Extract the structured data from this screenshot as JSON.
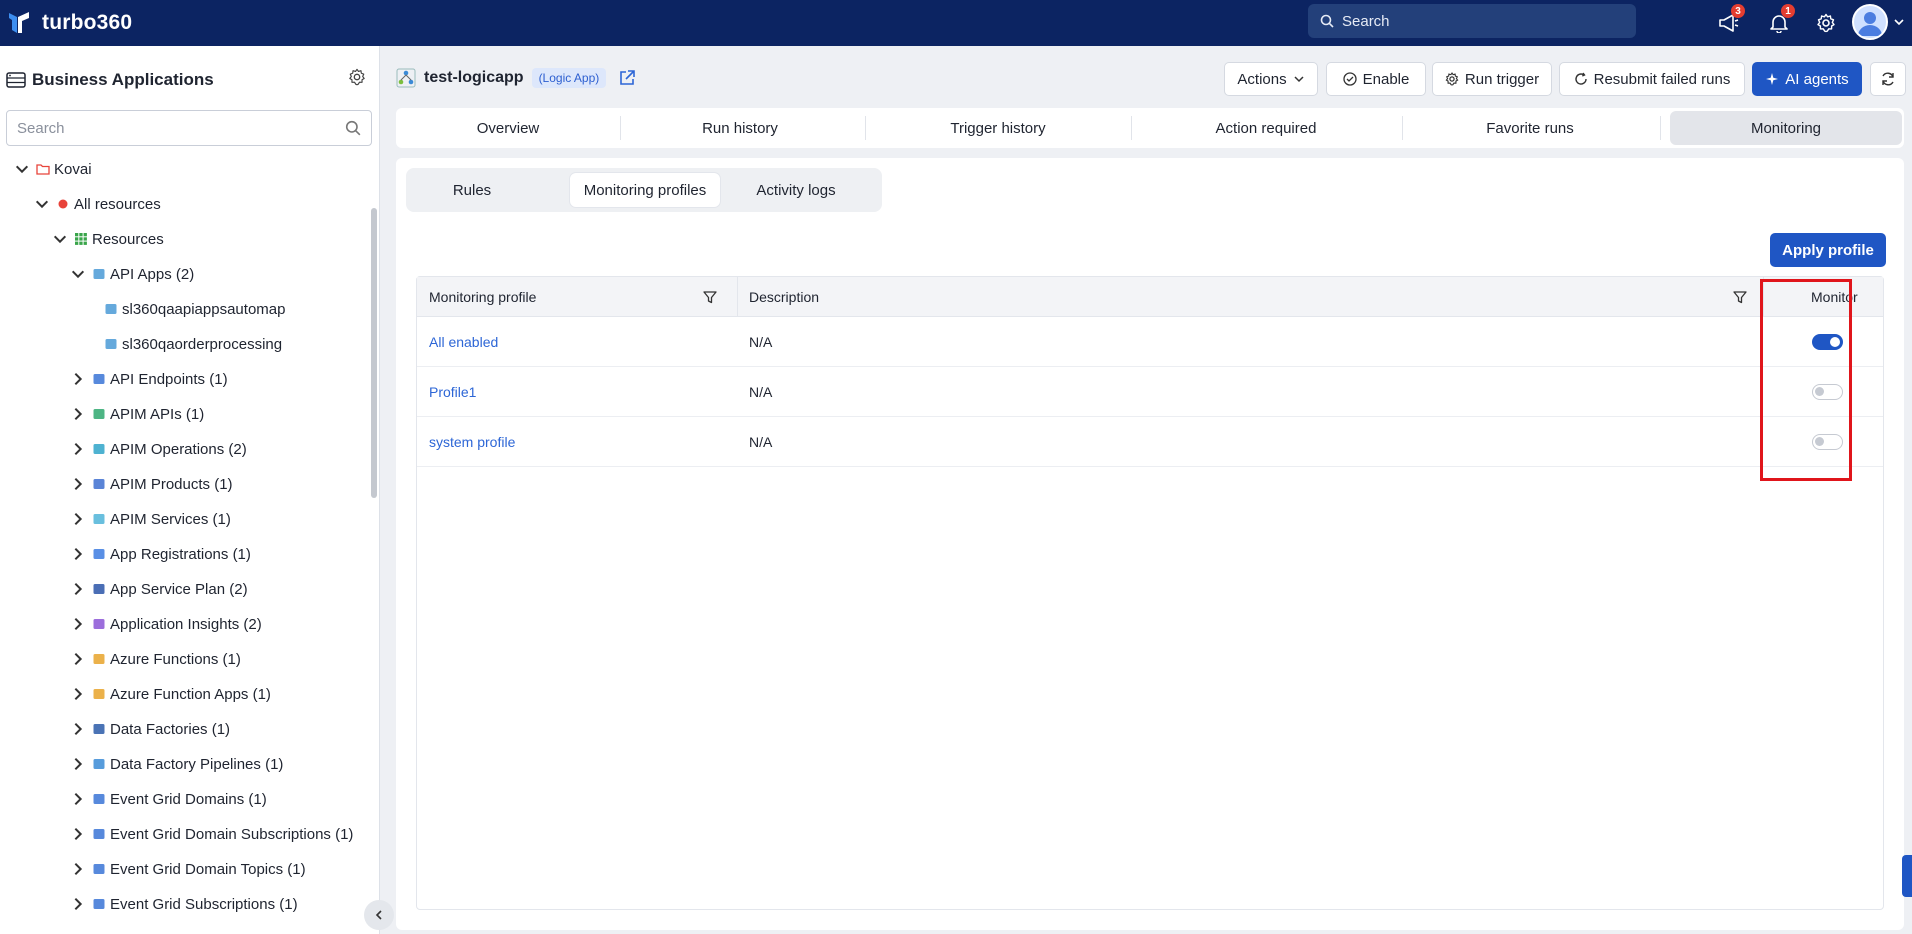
{
  "topbar": {
    "brand": "turbo360",
    "search_placeholder": "Search",
    "announcements_count": "3",
    "notifications_count": "1",
    "icons": [
      "megaphone-icon",
      "bell-icon",
      "gear-icon",
      "avatar"
    ]
  },
  "sidebar": {
    "title": "Business Applications",
    "search_placeholder": "Search",
    "tree": [
      {
        "label": "Kovai",
        "level": 0,
        "expanded": true,
        "icon": "folder-icon"
      },
      {
        "label": "All resources",
        "level": 1,
        "expanded": true,
        "icon": "status-dot-icon"
      },
      {
        "label": "Resources",
        "level": 2,
        "expanded": true,
        "icon": "grid-icon"
      },
      {
        "label": "API Apps (2)",
        "level": 3,
        "expanded": true,
        "icon": "api-app-icon"
      },
      {
        "label": "sl360qaapiappsautomap",
        "level": 4,
        "icon": "api-app-icon"
      },
      {
        "label": "sl360qaorderprocessing",
        "level": 4,
        "icon": "api-app-icon"
      },
      {
        "label": "API Endpoints (1)",
        "level": 3,
        "expanded": false,
        "icon": "api-endpoint-icon"
      },
      {
        "label": "APIM APIs (1)",
        "level": 3,
        "expanded": false,
        "icon": "apim-api-icon"
      },
      {
        "label": "APIM Operations (2)",
        "level": 3,
        "expanded": false,
        "icon": "apim-operation-icon"
      },
      {
        "label": "APIM Products (1)",
        "level": 3,
        "expanded": false,
        "icon": "apim-product-icon"
      },
      {
        "label": "APIM Services (1)",
        "level": 3,
        "expanded": false,
        "icon": "apim-service-icon"
      },
      {
        "label": "App Registrations (1)",
        "level": 3,
        "expanded": false,
        "icon": "app-registration-icon"
      },
      {
        "label": "App Service Plan (2)",
        "level": 3,
        "expanded": false,
        "icon": "app-service-plan-icon"
      },
      {
        "label": "Application Insights (2)",
        "level": 3,
        "expanded": false,
        "icon": "insights-icon"
      },
      {
        "label": "Azure Functions (1)",
        "level": 3,
        "expanded": false,
        "icon": "function-icon"
      },
      {
        "label": "Azure Function Apps (1)",
        "level": 3,
        "expanded": false,
        "icon": "function-app-icon"
      },
      {
        "label": "Data Factories (1)",
        "level": 3,
        "expanded": false,
        "icon": "data-factory-icon"
      },
      {
        "label": "Data Factory Pipelines (1)",
        "level": 3,
        "expanded": false,
        "icon": "pipeline-icon"
      },
      {
        "label": "Event Grid Domains (1)",
        "level": 3,
        "expanded": false,
        "icon": "event-grid-icon"
      },
      {
        "label": "Event Grid Domain Subscriptions (1)",
        "level": 3,
        "expanded": false,
        "icon": "event-grid-icon"
      },
      {
        "label": "Event Grid Domain Topics (1)",
        "level": 3,
        "expanded": false,
        "icon": "event-grid-icon"
      },
      {
        "label": "Event Grid Subscriptions (1)",
        "level": 3,
        "expanded": false,
        "icon": "event-grid-icon"
      }
    ]
  },
  "header": {
    "app_name": "test-logicapp",
    "app_type": "(Logic App)",
    "buttons": {
      "actions": "Actions",
      "enable": "Enable",
      "run_trigger": "Run trigger",
      "resubmit": "Resubmit failed runs",
      "ai_agents": "AI agents"
    }
  },
  "tabs": [
    "Overview",
    "Run history",
    "Trigger history",
    "Action required",
    "Favorite runs",
    "Monitoring"
  ],
  "active_tab": "Monitoring",
  "subtabs": [
    "Rules",
    "Monitoring profiles",
    "Activity logs"
  ],
  "active_subtab": "Monitoring profiles",
  "apply_profile_label": "Apply profile",
  "table": {
    "columns": [
      "Monitoring profile",
      "Description",
      "Monitor"
    ],
    "rows": [
      {
        "profile": "All enabled",
        "description": "N/A",
        "monitor": true
      },
      {
        "profile": "Profile1",
        "description": "N/A",
        "monitor": false
      },
      {
        "profile": "system profile",
        "description": "N/A",
        "monitor": false
      }
    ]
  },
  "colors": {
    "topbar": "#0c2462",
    "primary": "#1f56c4",
    "link": "#2d66d6",
    "highlight": "#e0151b"
  }
}
